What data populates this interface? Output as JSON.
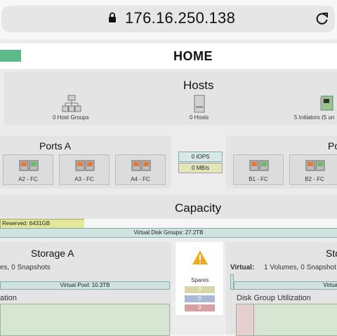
{
  "browser": {
    "url": "176.16.250.138"
  },
  "header": {
    "title": "HOME"
  },
  "hosts": {
    "title": "Hosts",
    "host_groups": "0 Host Groups",
    "hosts": "0 Hosts",
    "initiators": "5 Initiators (5 un"
  },
  "ports_a": {
    "title": "Ports A",
    "items": [
      "A2 - FC",
      "A3 - FC",
      "A4 - FC"
    ]
  },
  "ports_b": {
    "title": "Po",
    "items": [
      "B1 - FC",
      "B2 - FC"
    ]
  },
  "iops": {
    "iops": "0 IOPS",
    "mbs": "0 MB/s"
  },
  "capacity": {
    "title": "Capacity",
    "reserved": "Reserved: 6431GB",
    "vdisk_groups": "Virtual Disk Groups: 27.2TB"
  },
  "storage_a": {
    "title": "Storage A",
    "snapshots": "es, 0 Snapshots",
    "virtual_pool": "Virtual Pool: 10.3TB",
    "utilization_label": "ation"
  },
  "spares": {
    "title": "Spares",
    "values": [
      "0",
      "0",
      "0"
    ]
  },
  "storage_b": {
    "title": "Sto",
    "virtual_label": "Virtual:",
    "virtual_value": "1 Volumes, 0 Snapshot",
    "virtual_pool": "Virtua",
    "utilization_label": "Disk Group Utilization"
  },
  "colors": {
    "accent": "#5dba8a",
    "reserved": "#e2e79a",
    "vdisk": "#cfe3e0",
    "spare1": "#d6d6a8",
    "spare2": "#a8b8d6",
    "spare3": "#d6a0a0",
    "warning": "#f0a91d"
  }
}
